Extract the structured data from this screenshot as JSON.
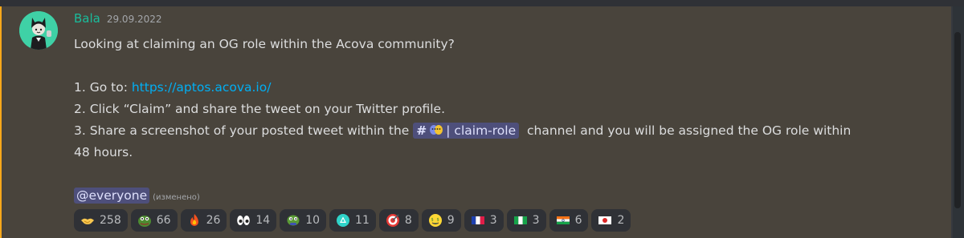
{
  "message": {
    "author": "Bala",
    "timestamp": "29.09.2022",
    "lines": {
      "intro": "Looking at claiming an OG role within the Acova community?",
      "step1_prefix": "1. Go to: ",
      "step1_link": "https://aptos.acova.io/",
      "step2": "2. Click “Claim” and share the tweet on your Twitter profile.",
      "step3_prefix": "3. Share a screenshot of your posted tweet within the ",
      "step3_channel": "| claim-role",
      "step3_suffix": "  channel and you will be assigned the OG role within",
      "step3_cont": "48 hours."
    },
    "mention": "@everyone",
    "edited": "(изменено)"
  },
  "reactions": [
    {
      "icon": "handshake-emoji-icon",
      "count": "258"
    },
    {
      "icon": "pepe-emoji-icon",
      "count": "66"
    },
    {
      "icon": "fire-emoji-icon",
      "count": "26"
    },
    {
      "icon": "eyes-emoji-icon",
      "count": "14"
    },
    {
      "icon": "pepe-clap-emoji-icon",
      "count": "10"
    },
    {
      "icon": "aptos-triangle-emoji-icon",
      "count": "11"
    },
    {
      "icon": "target-emoji-icon",
      "count": "8"
    },
    {
      "icon": "money-face-emoji-icon",
      "count": "9"
    },
    {
      "icon": "france-flag-emoji-icon",
      "count": "3"
    },
    {
      "icon": "nigeria-flag-emoji-icon",
      "count": "3"
    },
    {
      "icon": "india-flag-emoji-icon",
      "count": "6"
    },
    {
      "icon": "japan-flag-emoji-icon",
      "count": "2"
    }
  ],
  "colors": {
    "background": "#36393f",
    "highlight": "#49443c",
    "highlight_border": "#faa81a",
    "username": "#1abc9c",
    "link": "#00aff4",
    "mention_bg": "#5865f2"
  }
}
